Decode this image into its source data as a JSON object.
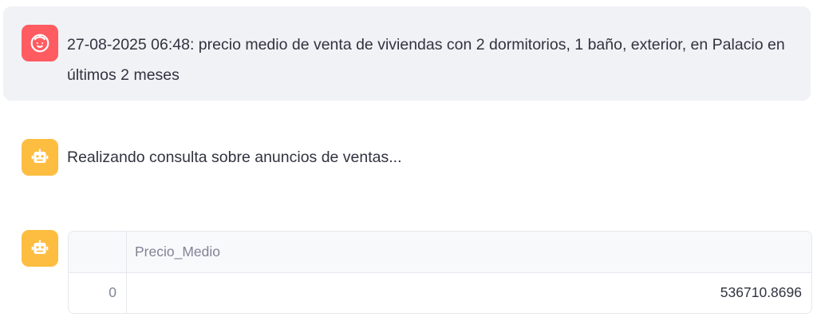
{
  "messages": {
    "user_query": {
      "text": "27-08-2025 06:48: precio medio de venta de viviendas con 2 dormitorios, 1 baño, exterior, en Palacio en últimos 2 meses",
      "avatar_icon": "user-face-icon"
    },
    "bot_status": {
      "text": "Realizando consulta sobre anuncios de ventas...",
      "avatar_icon": "robot-icon"
    },
    "bot_result": {
      "avatar_icon": "robot-icon",
      "table": {
        "columns": [
          "Precio_Medio"
        ],
        "rows": [
          {
            "index": "0",
            "values": [
              "536710.8696"
            ]
          }
        ]
      }
    }
  },
  "colors": {
    "user_avatar_bg": "#ff5c62",
    "bot_avatar_bg": "#fdbd41",
    "user_bubble_bg": "#f0f2f6",
    "text": "#31333f",
    "muted_text": "#808495"
  }
}
